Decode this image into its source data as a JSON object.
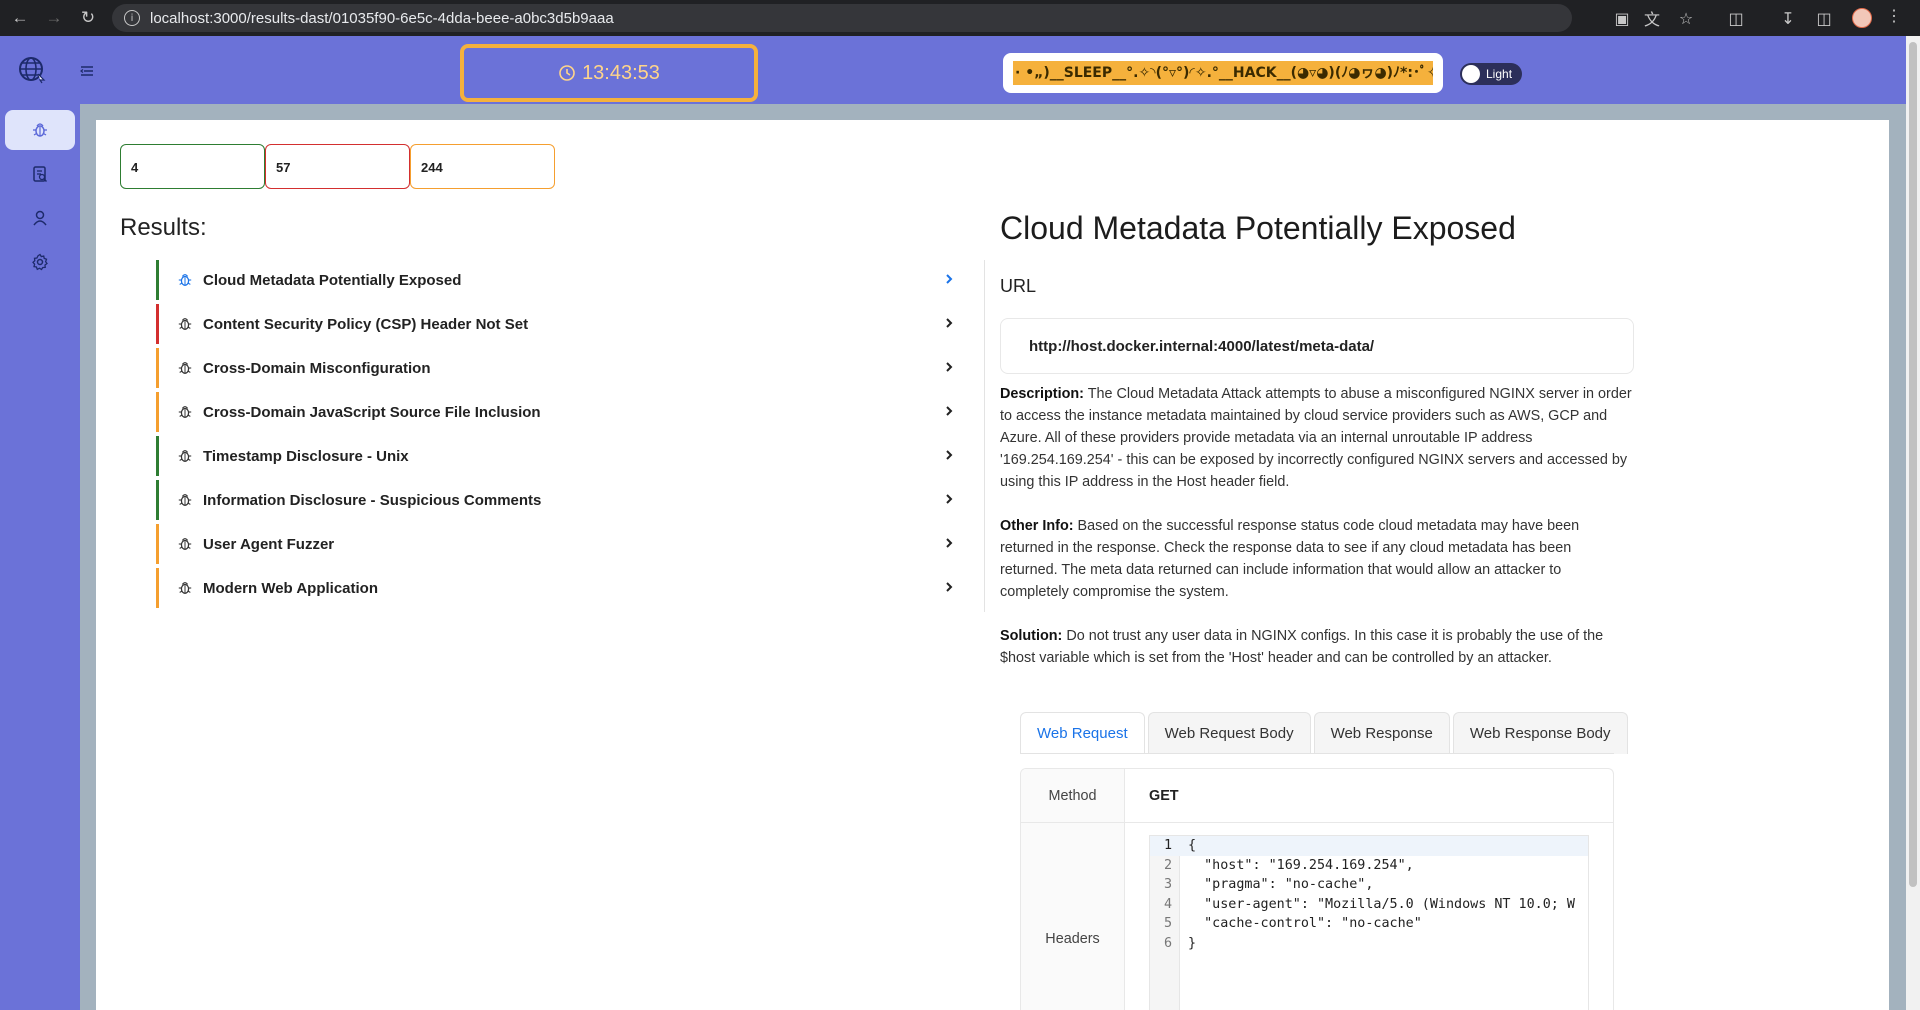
{
  "browser": {
    "url": "localhost:3000/results-dast/01035f90-6e5c-4dda-beee-a0bc3d5b9aaa"
  },
  "header": {
    "timer": "13:43:53",
    "marquee": "· •„)__SLEEP__°.✧◝(°▿°)◜✧.°__HACK__(◕▿◕)(ﾉ◕ヮ◕)ﾉ*:･ﾟ✧__EA",
    "theme_label": "Light"
  },
  "sidebar": {
    "items": [
      {
        "name": "bug-icon",
        "active": true
      },
      {
        "name": "report-icon",
        "active": false
      },
      {
        "name": "user-icon",
        "active": false
      },
      {
        "name": "gear-icon",
        "active": false
      }
    ]
  },
  "stats": {
    "green": "4",
    "red": "57",
    "orange": "244"
  },
  "results": {
    "title": "Results:",
    "items": [
      {
        "title": "Cloud Metadata Potentially Exposed",
        "severity": "green",
        "selected": true
      },
      {
        "title": "Content Security Policy (CSP) Header Not Set",
        "severity": "red",
        "selected": false
      },
      {
        "title": "Cross-Domain Misconfiguration",
        "severity": "orange",
        "selected": false
      },
      {
        "title": "Cross-Domain JavaScript Source File Inclusion",
        "severity": "orange",
        "selected": false
      },
      {
        "title": "Timestamp Disclosure - Unix",
        "severity": "green",
        "selected": false
      },
      {
        "title": "Information Disclosure - Suspicious Comments",
        "severity": "green",
        "selected": false
      },
      {
        "title": "User Agent Fuzzer",
        "severity": "orange",
        "selected": false
      },
      {
        "title": "Modern Web Application",
        "severity": "orange",
        "selected": false
      }
    ]
  },
  "detail": {
    "title": "Cloud Metadata Potentially Exposed",
    "url_label": "URL",
    "url": "http://host.docker.internal:4000/latest/meta-data/",
    "description_label": "Description:",
    "description": "The Cloud Metadata Attack attempts to abuse a misconfigured NGINX server in order to access the instance metadata maintained by cloud service providers such as AWS, GCP and Azure. All of these providers provide metadata via an internal unroutable IP address '169.254.169.254' - this can be exposed by incorrectly configured NGINX servers and accessed by using this IP address in the Host header field.",
    "other_info_label": "Other Info:",
    "other_info": "Based on the successful response status code cloud metadata may have been returned in the response. Check the response data to see if any cloud metadata has been returned. The meta data returned can include information that would allow an attacker to completely compromise the system.",
    "solution_label": "Solution:",
    "solution": "Do not trust any user data in NGINX configs. In this case it is probably the use of the $host variable which is set from the 'Host' header and can be controlled by an attacker.",
    "tabs": [
      "Web Request",
      "Web Request Body",
      "Web Response",
      "Web Response Body"
    ],
    "request": {
      "method_label": "Method",
      "method": "GET",
      "headers_label": "Headers",
      "code_lines": [
        {
          "n": "1",
          "text": "{"
        },
        {
          "n": "2",
          "text": "  \"host\": \"169.254.169.254\","
        },
        {
          "n": "3",
          "text": "  \"pragma\": \"no-cache\","
        },
        {
          "n": "4",
          "text": "  \"user-agent\": \"Mozilla/5.0 (Windows NT 10.0; W"
        },
        {
          "n": "5",
          "text": "  \"cache-control\": \"no-cache\""
        },
        {
          "n": "6",
          "text": "}"
        }
      ]
    }
  },
  "colors": {
    "primary": "#6b72d8",
    "green": "#2e7d32",
    "red": "#d32f2f",
    "orange": "#f59f2f",
    "link": "#1a73e8"
  }
}
